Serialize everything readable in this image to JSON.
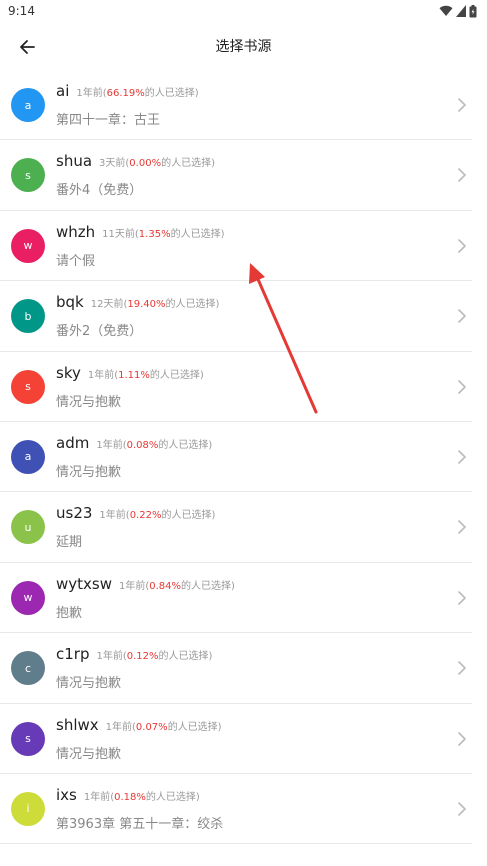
{
  "status": {
    "time": "9:14"
  },
  "header": {
    "title": "选择书源"
  },
  "list_text": {
    "pct_suffix": "的人已选择)"
  },
  "items": [
    {
      "letter": "a",
      "name": "ai",
      "time": "1年前(",
      "pct": "66.19%",
      "chapter": "第四十一章：古王",
      "color": "#2196F3"
    },
    {
      "letter": "s",
      "name": "shua",
      "time": "3天前(",
      "pct": "0.00%",
      "chapter": "番外4（免费）",
      "color": "#4CAF50"
    },
    {
      "letter": "w",
      "name": "whzh",
      "time": "11天前(",
      "pct": "1.35%",
      "chapter": "请个假",
      "color": "#E91E63"
    },
    {
      "letter": "b",
      "name": "bqk",
      "time": "12天前(",
      "pct": "19.40%",
      "chapter": "番外2（免费）",
      "color": "#009688"
    },
    {
      "letter": "s",
      "name": "sky",
      "time": "1年前(",
      "pct": "1.11%",
      "chapter": "情况与抱歉",
      "color": "#F44336"
    },
    {
      "letter": "a",
      "name": "adm",
      "time": "1年前(",
      "pct": "0.08%",
      "chapter": "情况与抱歉",
      "color": "#3F51B5"
    },
    {
      "letter": "u",
      "name": "us23",
      "time": "1年前(",
      "pct": "0.22%",
      "chapter": "延期",
      "color": "#8BC34A"
    },
    {
      "letter": "w",
      "name": "wytxsw",
      "time": "1年前(",
      "pct": "0.84%",
      "chapter": "抱歉",
      "color": "#9C27B0"
    },
    {
      "letter": "c",
      "name": "c1rp",
      "time": "1年前(",
      "pct": "0.12%",
      "chapter": "情况与抱歉",
      "color": "#607D8B"
    },
    {
      "letter": "s",
      "name": "shlwx",
      "time": "1年前(",
      "pct": "0.07%",
      "chapter": "情况与抱歉",
      "color": "#673AB7"
    },
    {
      "letter": "i",
      "name": "ixs",
      "time": "1年前(",
      "pct": "0.18%",
      "chapter": "第3963章 第五十一章：绞杀",
      "color": "#CDDC39"
    }
  ],
  "colors": {
    "accent": "#e53935",
    "arrow": "#e53935"
  },
  "icons": {
    "back": "arrow-left-icon",
    "chevron": "chevron-right-icon",
    "wifi": "wifi-icon",
    "signal": "signal-icon",
    "battery": "battery-icon"
  }
}
